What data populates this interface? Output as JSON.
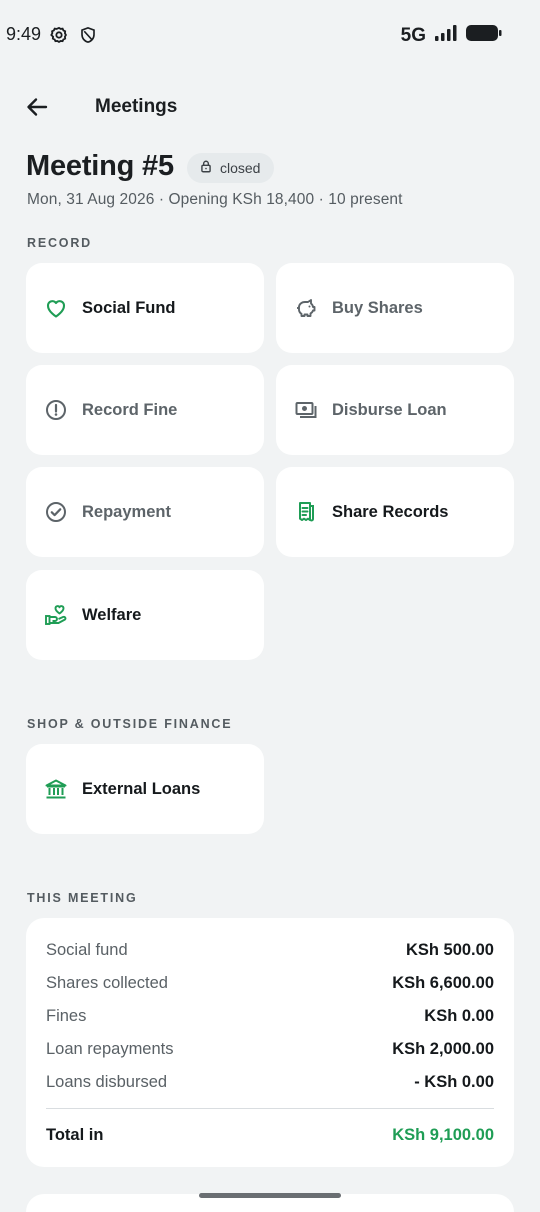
{
  "status_bar": {
    "time": "9:49",
    "network": "5G"
  },
  "topbar": {
    "title": "Meetings"
  },
  "meeting": {
    "title": "Meeting #5",
    "status": "closed",
    "subtitle": "Mon, 31 Aug 2026 · Opening KSh 18,400 · 10 present"
  },
  "sections": {
    "record": "RECORD",
    "shop": "SHOP & OUTSIDE FINANCE",
    "this_meeting": "THIS MEETING"
  },
  "record_actions": [
    {
      "label": "Social Fund",
      "icon": "heart-icon",
      "enabled": true
    },
    {
      "label": "Buy Shares",
      "icon": "piggy-bank-icon",
      "enabled": false
    },
    {
      "label": "Record Fine",
      "icon": "alert-circle-icon",
      "enabled": false
    },
    {
      "label": "Disburse Loan",
      "icon": "cash-icon",
      "enabled": false
    },
    {
      "label": "Repayment",
      "icon": "check-circle-icon",
      "enabled": false
    },
    {
      "label": "Share Records",
      "icon": "receipt-icon",
      "enabled": true
    },
    {
      "label": "Welfare",
      "icon": "hand-heart-icon",
      "enabled": true
    }
  ],
  "shop_actions": [
    {
      "label": "External Loans",
      "icon": "bank-icon",
      "enabled": true
    }
  ],
  "summary": {
    "rows": [
      {
        "label": "Social fund",
        "value": "KSh 500.00"
      },
      {
        "label": "Shares collected",
        "value": "KSh 6,600.00"
      },
      {
        "label": "Fines",
        "value": "KSh 0.00"
      },
      {
        "label": "Loan repayments",
        "value": "KSh 2,000.00"
      },
      {
        "label": "Loans disbursed",
        "value": "- KSh 0.00"
      }
    ],
    "total_label": "Total in",
    "total_value": "KSh 9,100.00"
  },
  "colors": {
    "accent": "#1f9d55",
    "background": "#f1f3f4",
    "card": "#ffffff"
  }
}
